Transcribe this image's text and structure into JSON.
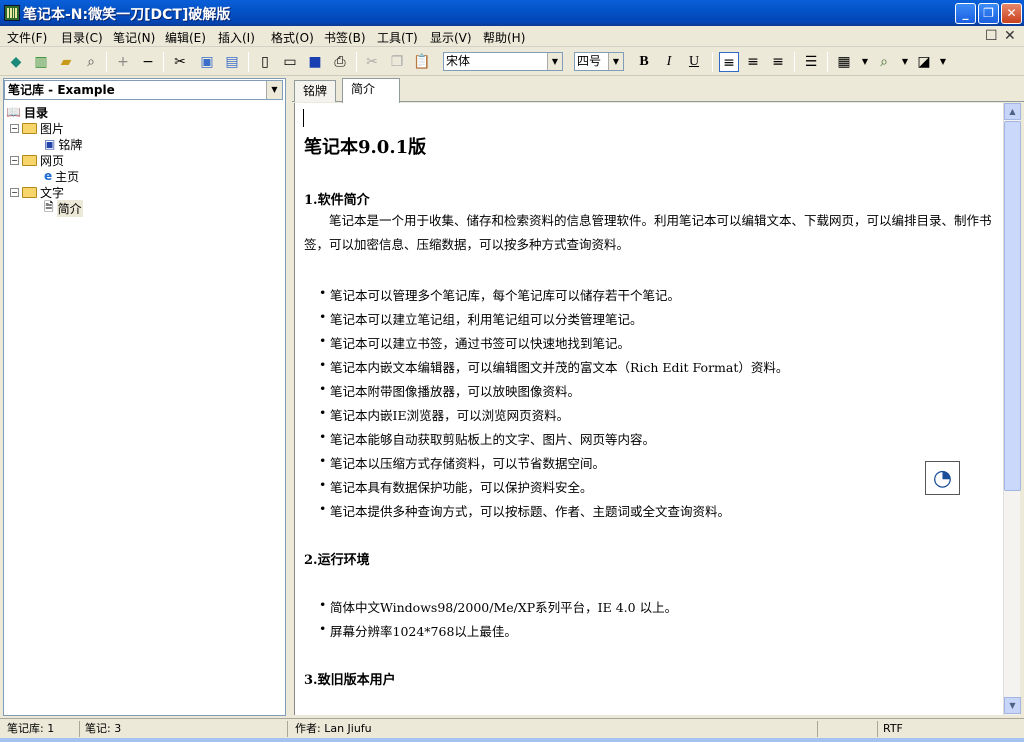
{
  "window": {
    "title": "笔记本-N:微笑一刀[DCT]破解版"
  },
  "menu": [
    "文件(F)",
    "目录(C)",
    "笔记(N)",
    "编辑(E)",
    "插入(I)",
    "格式(O)",
    "书签(B)",
    "工具(T)",
    "显示(V)",
    "帮助(H)"
  ],
  "toolbar": {
    "font": "宋体",
    "size": "四号",
    "bold": "B",
    "italic": "I",
    "underline": "U"
  },
  "library": {
    "name": "笔记库 - Example"
  },
  "tree": {
    "root": "目录",
    "folder1": "图片",
    "item1": "铭牌",
    "folder2": "网页",
    "item2": "主页",
    "folder3": "文字",
    "item3": "简介"
  },
  "tabs": [
    "铭牌",
    "简介"
  ],
  "doc": {
    "title": "笔记本9.0.1版",
    "s1": "1.软件简介",
    "intro": "　　笔记本是一个用于收集、储存和检索资料的信息管理软件。利用笔记本可以编辑文本、下载网页，可以编排目录、制作书签，可以加密信息、压缩数据，可以按多种方式查询资料。",
    "bullets": [
      "笔记本可以管理多个笔记库，每个笔记库可以储存若干个笔记。",
      "笔记本可以建立笔记组，利用笔记组可以分类管理笔记。",
      "笔记本可以建立书签，通过书签可以快速地找到笔记。",
      "笔记本内嵌文本编辑器，可以编辑图文并茂的富文本（Rich Edit Format）资料。",
      "笔记本附带图像播放器，可以放映图像资料。",
      "笔记本内嵌IE浏览器，可以浏览网页资料。",
      "笔记本能够自动获取剪贴板上的文字、图片、网页等内容。",
      "笔记本以压缩方式存储资料，可以节省数据空间。",
      "笔记本具有数据保护功能，可以保护资料安全。",
      "笔记本提供多种查询方式，可以按标题、作者、主题词或全文查询资料。"
    ],
    "s2": "2.运行环境",
    "env1": "简体中文Windows98/2000/Me/XP系列平台，IE 4.0 以上。",
    "env2": "屏幕分辨率1024*768以上最佳。",
    "s3": "3.致旧版本用户"
  },
  "status": {
    "lib": "笔记库: 1",
    "notes": "笔记: 3",
    "author": "作者: Lan Jiufu",
    "format": "RTF"
  }
}
